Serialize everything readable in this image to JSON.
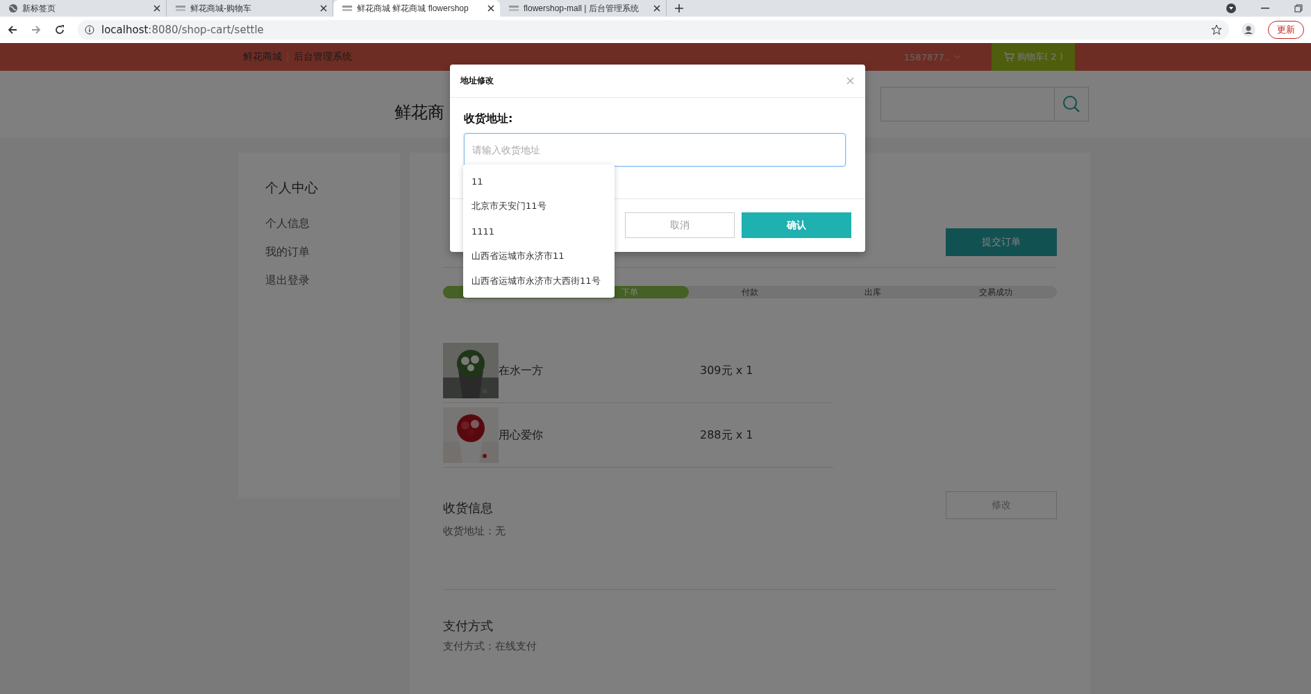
{
  "browser": {
    "tabs": [
      {
        "title": "新标签页",
        "selected": false
      },
      {
        "title": "鲜花商城-购物车",
        "selected": false
      },
      {
        "title": "鲜花商城 鲜花商城 flowershop",
        "selected": true
      },
      {
        "title": "flowershop-mall | 后台管理系统",
        "selected": false
      }
    ],
    "url_host": "localhost",
    "url_rest": ":8080/shop-cart/settle",
    "update_button": "更新"
  },
  "navbar": {
    "links": [
      "鲜花商城",
      "后台管理系统"
    ],
    "user": "1587877..",
    "cart": "购物车( 2 )"
  },
  "header": {
    "title": "鲜花商"
  },
  "sidebar": {
    "title": "个人中心",
    "items": [
      "个人信息",
      "我的订单",
      "退出登录"
    ]
  },
  "main": {
    "submit_button": "提交订单",
    "progress": {
      "level": 0.4,
      "steps": [
        {
          "label": "下单",
          "done": true
        },
        {
          "label": "付款",
          "done": false
        },
        {
          "label": "出库",
          "done": false
        },
        {
          "label": "交易成功",
          "done": false
        }
      ]
    },
    "products": [
      {
        "name": "在水一方",
        "price": "309元 x 1",
        "kind": "picture"
      },
      {
        "name": "用心爱你",
        "price": "288元 x 1",
        "kind": "picture"
      }
    ],
    "shipping": {
      "title": "收货信息",
      "label": "收货地址：",
      "value": "无",
      "edit_button": "修改"
    },
    "payment": {
      "title": "支付方式",
      "label": "支付方式：",
      "value": "在线支付"
    }
  },
  "modal": {
    "title": "地址修改",
    "field_label": "收货地址:",
    "placeholder": "请输入收货地址",
    "suggestions": [
      "11",
      "北京市天安门11号",
      "1111",
      "山西省运城市永济市11",
      "山西省运城市永济市大西街11号"
    ],
    "cancel_button": "取消",
    "confirm_button": "确认"
  }
}
